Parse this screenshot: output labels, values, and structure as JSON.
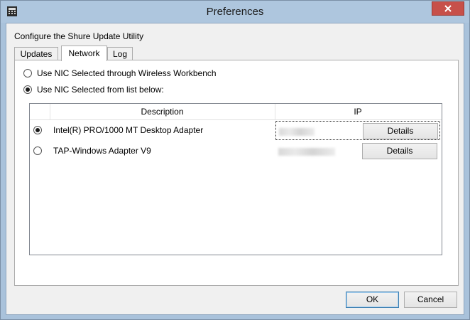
{
  "window": {
    "title": "Preferences",
    "app_icon": "calculator-grid-icon",
    "close_icon": "close-icon",
    "close_color": "#c7504a"
  },
  "heading": "Configure the Shure Update Utility",
  "tabs": [
    {
      "label": "Updates",
      "active": false
    },
    {
      "label": "Network",
      "active": true
    },
    {
      "label": "Log",
      "active": false
    }
  ],
  "network": {
    "options": [
      {
        "label": "Use NIC Selected through Wireless Workbench",
        "checked": false
      },
      {
        "label": "Use NIC Selected from list below:",
        "checked": true
      }
    ],
    "table": {
      "columns": [
        "Description",
        "IP"
      ],
      "rows": [
        {
          "description": "Intel(R) PRO/1000 MT Desktop Adapter",
          "selected": true,
          "details_label": "Details"
        },
        {
          "description": "TAP-Windows Adapter V9",
          "selected": false,
          "details_label": "Details"
        }
      ]
    }
  },
  "buttons": {
    "ok": "OK",
    "cancel": "Cancel"
  }
}
